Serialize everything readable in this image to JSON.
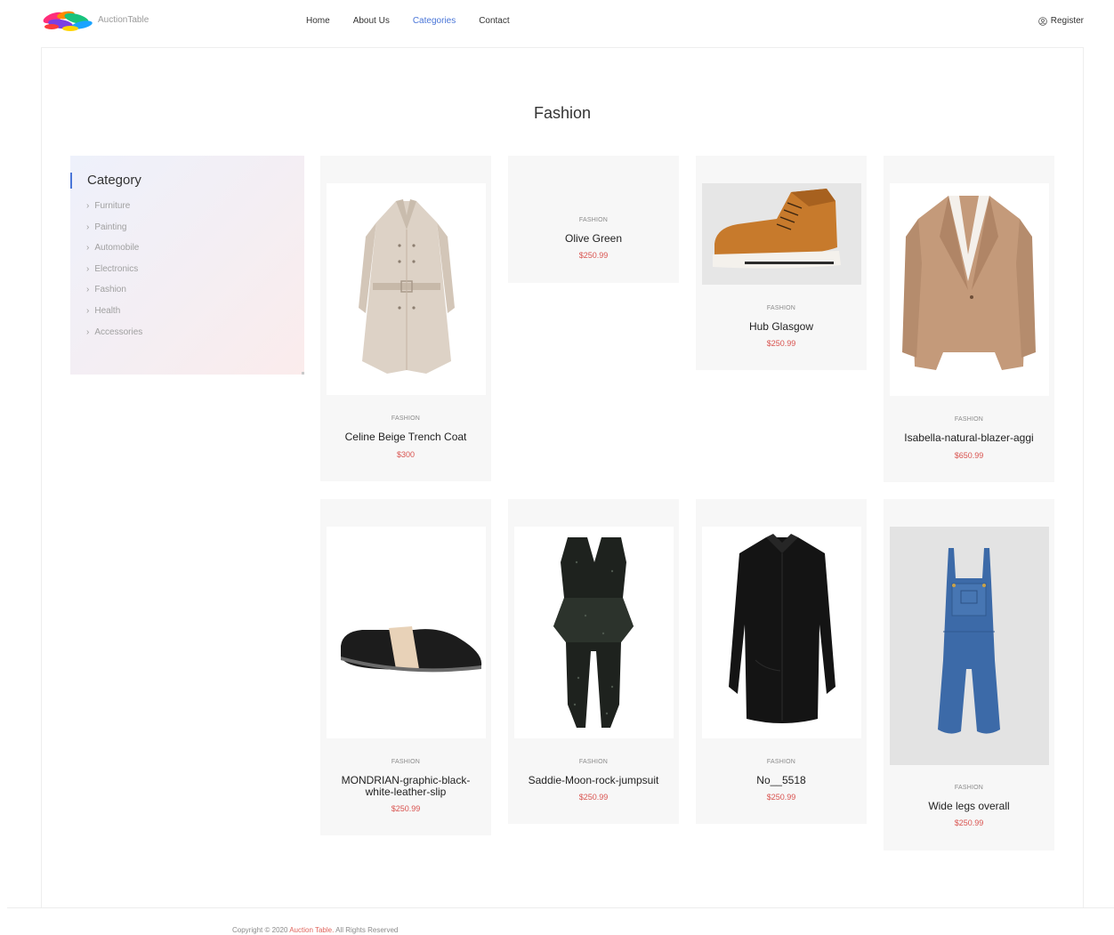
{
  "header": {
    "logo_text": "AuctionTable",
    "nav": [
      "Home",
      "About Us",
      "Categories",
      "Contact"
    ],
    "active_nav": "Categories",
    "register_label": "Register"
  },
  "page": {
    "title": "Fashion"
  },
  "sidebar": {
    "title": "Category",
    "items": [
      "Furniture",
      "Painting",
      "Automobile",
      "Electronics",
      "Fashion",
      "Health",
      "Accessories"
    ]
  },
  "products": [
    {
      "category": "FASHION",
      "name": "Celine Beige Trench Coat",
      "price": "$300",
      "image": "trench-coat"
    },
    {
      "category": "FASHION",
      "name": "Olive Green",
      "price": "$250.99",
      "image": "none"
    },
    {
      "category": "FASHION",
      "name": "Hub Glasgow",
      "price": "$250.99",
      "image": "sneaker"
    },
    {
      "category": "FASHION",
      "name": "Isabella-natural-blazer-aggi",
      "price": "$650.99",
      "image": "blazer"
    },
    {
      "category": "FASHION",
      "name": "MONDRIAN-graphic-black-white-leather-slip",
      "name_lines": [
        "MONDRIAN-graphic-black-",
        "white-leather-slip"
      ],
      "price": "$250.99",
      "image": "loafer"
    },
    {
      "category": "FASHION",
      "name": "Saddie-Moon-rock-jumpsuit",
      "price": "$250.99",
      "image": "jumpsuit"
    },
    {
      "category": "FASHION",
      "name": "No__5518",
      "price": "$250.99",
      "image": "black-shirt"
    },
    {
      "category": "FASHION",
      "name": "Wide legs overall",
      "price": "$250.99",
      "image": "denim-overall"
    }
  ],
  "footer": {
    "prefix": "Copyright",
    "year": "2020",
    "brand": "Auction Table.",
    "suffix": "All Rights Reserved"
  },
  "colors": {
    "accent": "#4a76d8",
    "price": "#d9534f",
    "card_bg": "#f7f7f7"
  }
}
